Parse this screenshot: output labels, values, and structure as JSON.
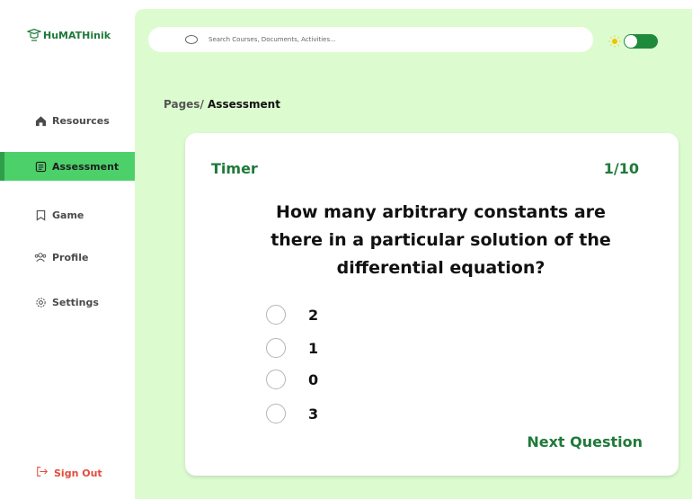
{
  "app": {
    "name": "HuMATHinik"
  },
  "sidebar": {
    "items": [
      {
        "label": "Resources",
        "icon": "home-icon"
      },
      {
        "label": "Assessment",
        "icon": "document-icon"
      },
      {
        "label": "Game",
        "icon": "bookmark-icon"
      },
      {
        "label": "Profile",
        "icon": "users-icon"
      },
      {
        "label": "Settings",
        "icon": "gear-icon"
      }
    ],
    "active": "Assessment",
    "signout": "Sign Out"
  },
  "header": {
    "search_placeholder": "Search Courses, Documents, Activities...",
    "theme_toggle_on": true
  },
  "breadcrumb": {
    "prefix": "Pages/",
    "current": "Assessment"
  },
  "quiz": {
    "timer_label": "Timer",
    "progress": "1/10",
    "question": "How many arbitrary constants are there in a particular solution of the differential equation?",
    "options": [
      "2",
      "1",
      "0",
      "3"
    ],
    "next_label": "Next Question"
  },
  "colors": {
    "accent": "#1f7a3a",
    "active_nav": "#4cd06a",
    "main_bg": "#dcfcd0",
    "signout": "#e44b3b"
  }
}
